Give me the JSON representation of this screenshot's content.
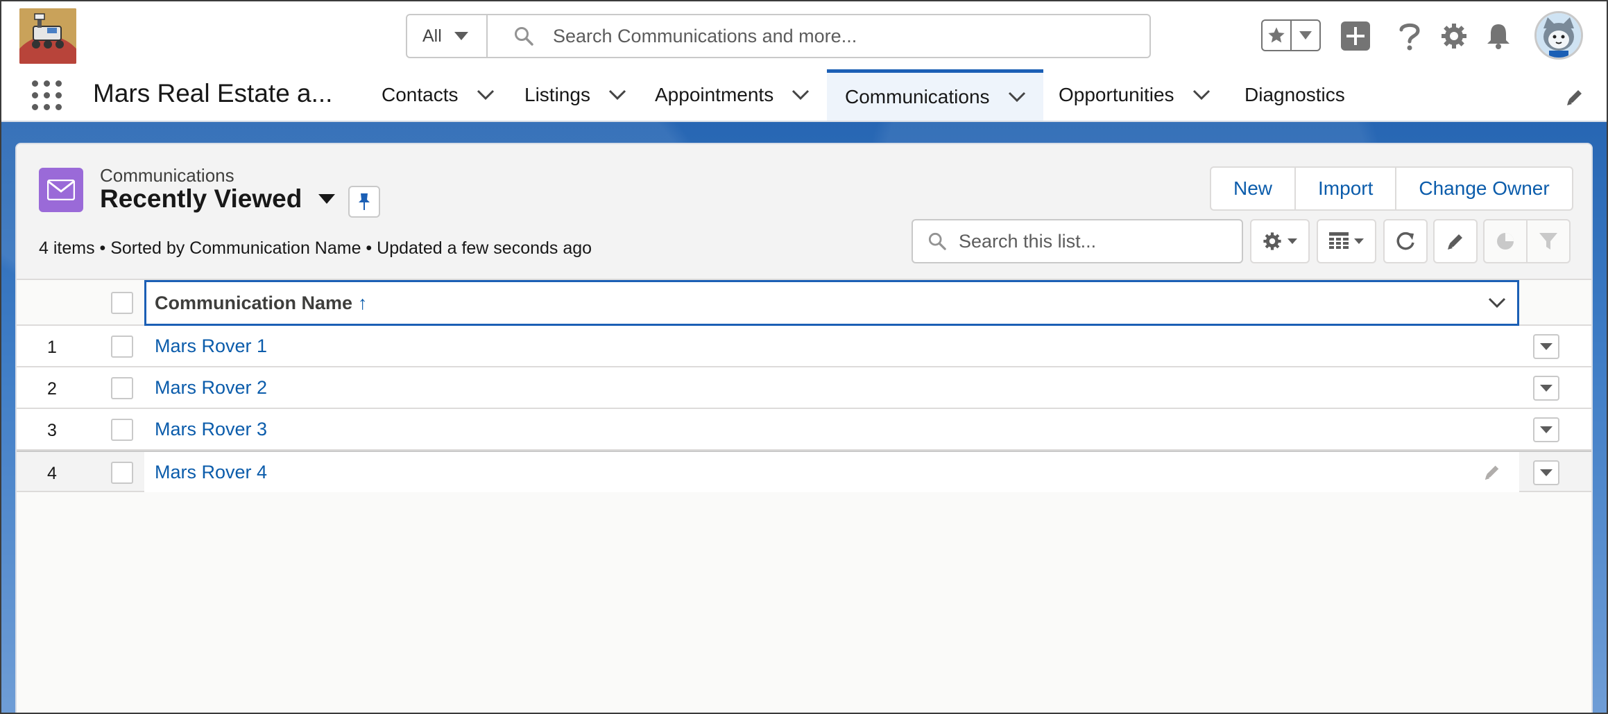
{
  "header": {
    "search_scope": "All",
    "search_placeholder": "Search Communications and more..."
  },
  "nav": {
    "app_name": "Mars Real Estate a...",
    "tabs": [
      {
        "label": "Contacts"
      },
      {
        "label": "Listings"
      },
      {
        "label": "Appointments"
      },
      {
        "label": "Communications",
        "active": true
      },
      {
        "label": "Opportunities"
      },
      {
        "label": "Diagnostics"
      }
    ]
  },
  "list_view": {
    "object_label": "Communications",
    "title": "Recently Viewed",
    "meta": "4 items • Sorted by Communication Name • Updated a few seconds ago",
    "buttons": {
      "new": "New",
      "import": "Import",
      "change_owner": "Change Owner"
    },
    "search_placeholder": "Search this list...",
    "column_header": "Communication Name",
    "sort_indicator": "↑",
    "rows": [
      {
        "num": "1",
        "name": "Mars Rover 1"
      },
      {
        "num": "2",
        "name": "Mars Rover 2"
      },
      {
        "num": "3",
        "name": "Mars Rover 3"
      },
      {
        "num": "4",
        "name": "Mars Rover 4"
      }
    ]
  },
  "icons": [
    "app-logo",
    "search-icon",
    "favorites-star-icon",
    "add-icon",
    "help-icon",
    "setup-gear-icon",
    "notifications-bell-icon",
    "avatar",
    "app-launcher-icon",
    "edit-nav-icon",
    "email-envelope-icon",
    "pin-icon",
    "list-settings-icon",
    "display-as-table-icon",
    "refresh-icon",
    "edit-icon",
    "chart-icon",
    "filter-icon"
  ],
  "colors": {
    "brand_blue": "#0b5cab",
    "active_tab_border": "#1b5fb5",
    "object_icon": "#9a6ad8"
  }
}
